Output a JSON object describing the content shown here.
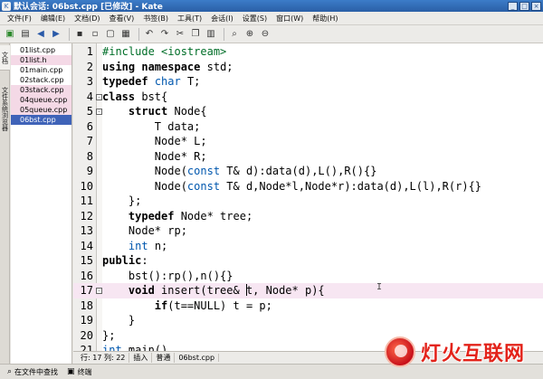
{
  "window": {
    "title": "默认会话: 06bst.cpp [已修改] - Kate"
  },
  "menu": [
    "文件(F)",
    "编辑(E)",
    "文档(D)",
    "查看(V)",
    "书签(B)",
    "工具(T)",
    "会话(I)",
    "设置(S)",
    "窗口(W)",
    "帮助(H)"
  ],
  "sidebar_tabs": {
    "documents": "文档",
    "filesystem": "文件系统浏览器"
  },
  "files": [
    {
      "name": "01list.cpp",
      "modified": false,
      "active": false
    },
    {
      "name": "01list.h",
      "modified": true,
      "active": false
    },
    {
      "name": "01main.cpp",
      "modified": false,
      "active": false
    },
    {
      "name": "02stack.cpp",
      "modified": false,
      "active": false
    },
    {
      "name": "03stack.cpp",
      "modified": true,
      "active": false
    },
    {
      "name": "04queue.cpp",
      "modified": true,
      "active": false
    },
    {
      "name": "05queue.cpp",
      "modified": true,
      "active": false
    },
    {
      "name": "06bst.cpp",
      "modified": false,
      "active": true
    }
  ],
  "editor": {
    "lines": [
      {
        "n": "1",
        "text": "#include <iostream>"
      },
      {
        "n": "2",
        "text": "using namespace std;"
      },
      {
        "n": "3",
        "text": "typedef char T;"
      },
      {
        "n": "4",
        "text": "class bst{"
      },
      {
        "n": "5",
        "text": "    struct Node{"
      },
      {
        "n": "6",
        "text": "        T data;"
      },
      {
        "n": "7",
        "text": "        Node* L;"
      },
      {
        "n": "8",
        "text": "        Node* R;"
      },
      {
        "n": "9",
        "text": "        Node(const T& d):data(d),L(),R(){}"
      },
      {
        "n": "10",
        "text": "        Node(const T& d,Node*l,Node*r):data(d),L(l),R(r){}"
      },
      {
        "n": "11",
        "text": "    };"
      },
      {
        "n": "12",
        "text": "    typedef Node* tree;"
      },
      {
        "n": "13",
        "text": "    Node* rp;"
      },
      {
        "n": "14",
        "text": "    int n;"
      },
      {
        "n": "15",
        "text": "public:"
      },
      {
        "n": "16",
        "text": "    bst():rp(),n(){}"
      },
      {
        "n": "17",
        "text": "    void insert(tree& t, Node* p){"
      },
      {
        "n": "18",
        "text": "        if(t==NULL) t = p;"
      },
      {
        "n": "19",
        "text": "    }"
      },
      {
        "n": "20",
        "text": "};"
      },
      {
        "n": "21",
        "text": "int main()"
      }
    ]
  },
  "status": {
    "position": "行: 17 列: 22",
    "mode": "插入",
    "encoding": "普通",
    "filename": "06bst.cpp"
  },
  "bottom_tabs": {
    "find_in_files": "在文件中查找",
    "terminal": "终端"
  },
  "watermark": {
    "text": "灯火互联网"
  }
}
